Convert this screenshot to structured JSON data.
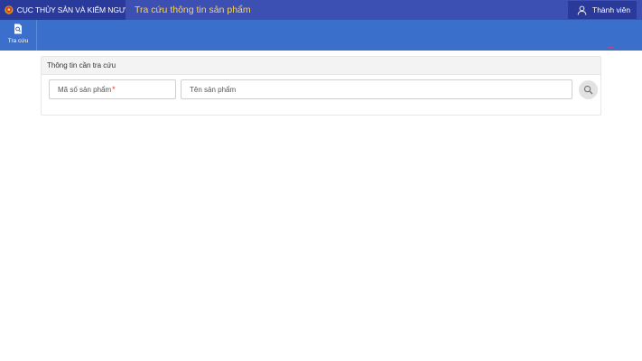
{
  "header": {
    "org_name": "CỤC THỦY SẢN VÀ KIỂM NGƯ",
    "page_title": "Tra cứu thông tin sản phẩm",
    "member_label": "Thành viên"
  },
  "nav": {
    "items": [
      {
        "label": "Tra cứu",
        "icon": "search-document-icon"
      }
    ]
  },
  "panel": {
    "title": "Thông tin cần tra cứu",
    "fields": {
      "product_code_label": "Mã số sản phẩm",
      "required_mark": "*",
      "product_name_label": "Tên sản phẩm"
    },
    "search_button_icon": "search-icon"
  },
  "colors": {
    "topbar": "#3c4fb2",
    "brand_bg": "#2a3a9a",
    "navbar": "#3a6fcc",
    "heading": "#ffd54a",
    "required": "#e53935"
  }
}
